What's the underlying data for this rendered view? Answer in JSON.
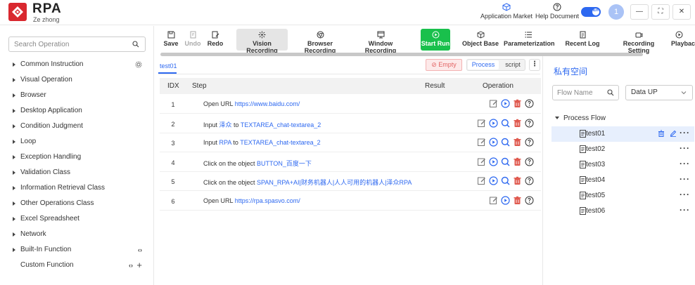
{
  "header": {
    "brand": "RPA",
    "brand_sub": "Ze zhong",
    "application_market": "Application Market",
    "help_document": "Help Document",
    "language_badge": "En",
    "avatar_initial": "1",
    "window_buttons": [
      "—",
      "⛶",
      "✕"
    ]
  },
  "sidebar": {
    "search_placeholder": "Search Operation",
    "items": [
      {
        "label": "Common Instruction"
      },
      {
        "label": "Visual Operation"
      },
      {
        "label": "Browser"
      },
      {
        "label": "Desktop Application"
      },
      {
        "label": "Condition Judgment"
      },
      {
        "label": "Loop"
      },
      {
        "label": "Exception Handling"
      },
      {
        "label": "Validation Class"
      },
      {
        "label": "Information Retrieval Class"
      },
      {
        "label": "Other Operations Class"
      },
      {
        "label": "Excel Spreadsheet"
      },
      {
        "label": "Network"
      },
      {
        "label": "Built-In Function",
        "code": "‹›"
      },
      {
        "label": "Custom Function",
        "code": "‹›",
        "plus": "+"
      }
    ]
  },
  "toolbar": {
    "save": "Save",
    "undo": "Undo",
    "redo": "Redo",
    "vision_recording": "Vision Recording",
    "browser_recording": "Browser Recording",
    "window_recording": "Window Recording",
    "start_run": "Start Run",
    "object_base": "Object Base",
    "parameterization": "Parameterization",
    "recent_log": "Recent Log",
    "recording_setting": "Recording Setting",
    "playback": "Playbaci"
  },
  "editor": {
    "active_tab": "test01",
    "empty_button": "⊘ Empty",
    "mode_process": "Process",
    "mode_script": "script",
    "kebab": "⋮",
    "columns": {
      "idx": "IDX",
      "step": "Step",
      "result": "Result",
      "operation": "Operation"
    },
    "rows": [
      {
        "idx": "1",
        "text": "Open URL ",
        "link": "https://www.baidu.com/",
        "mid": "",
        "link2": ""
      },
      {
        "idx": "2",
        "text": "Input ",
        "link": "泽众",
        "mid": " to ",
        "link2": "TEXTAREA_chat-textarea_2"
      },
      {
        "idx": "3",
        "text": "Input ",
        "link": "RPA",
        "mid": " to ",
        "link2": "TEXTAREA_chat-textarea_2"
      },
      {
        "idx": "4",
        "text": "Click on the object ",
        "link": "BUTTON_百度一下",
        "mid": "",
        "link2": ""
      },
      {
        "idx": "5",
        "text": "Click on the object ",
        "link": "SPAN_RPA+AI|财务机器人|人人可用的机器人|泽众RPA",
        "mid": "",
        "link2": ""
      },
      {
        "idx": "6",
        "text": "Open URL ",
        "link": "https://rpa.spasvo.com/",
        "mid": "",
        "link2": ""
      }
    ]
  },
  "right_panel": {
    "title": "私有空间",
    "flow_name_placeholder": "Flow Name",
    "sort_value": "Data UP",
    "tree_root": "Process Flow",
    "more": "···",
    "flows": [
      "test01",
      "test02",
      "test03",
      "test04",
      "test05",
      "test06"
    ]
  },
  "colors": {
    "accent": "#2d68f0",
    "run": "#19c04c",
    "danger": "#e05a4f",
    "brand": "#d9282f"
  }
}
